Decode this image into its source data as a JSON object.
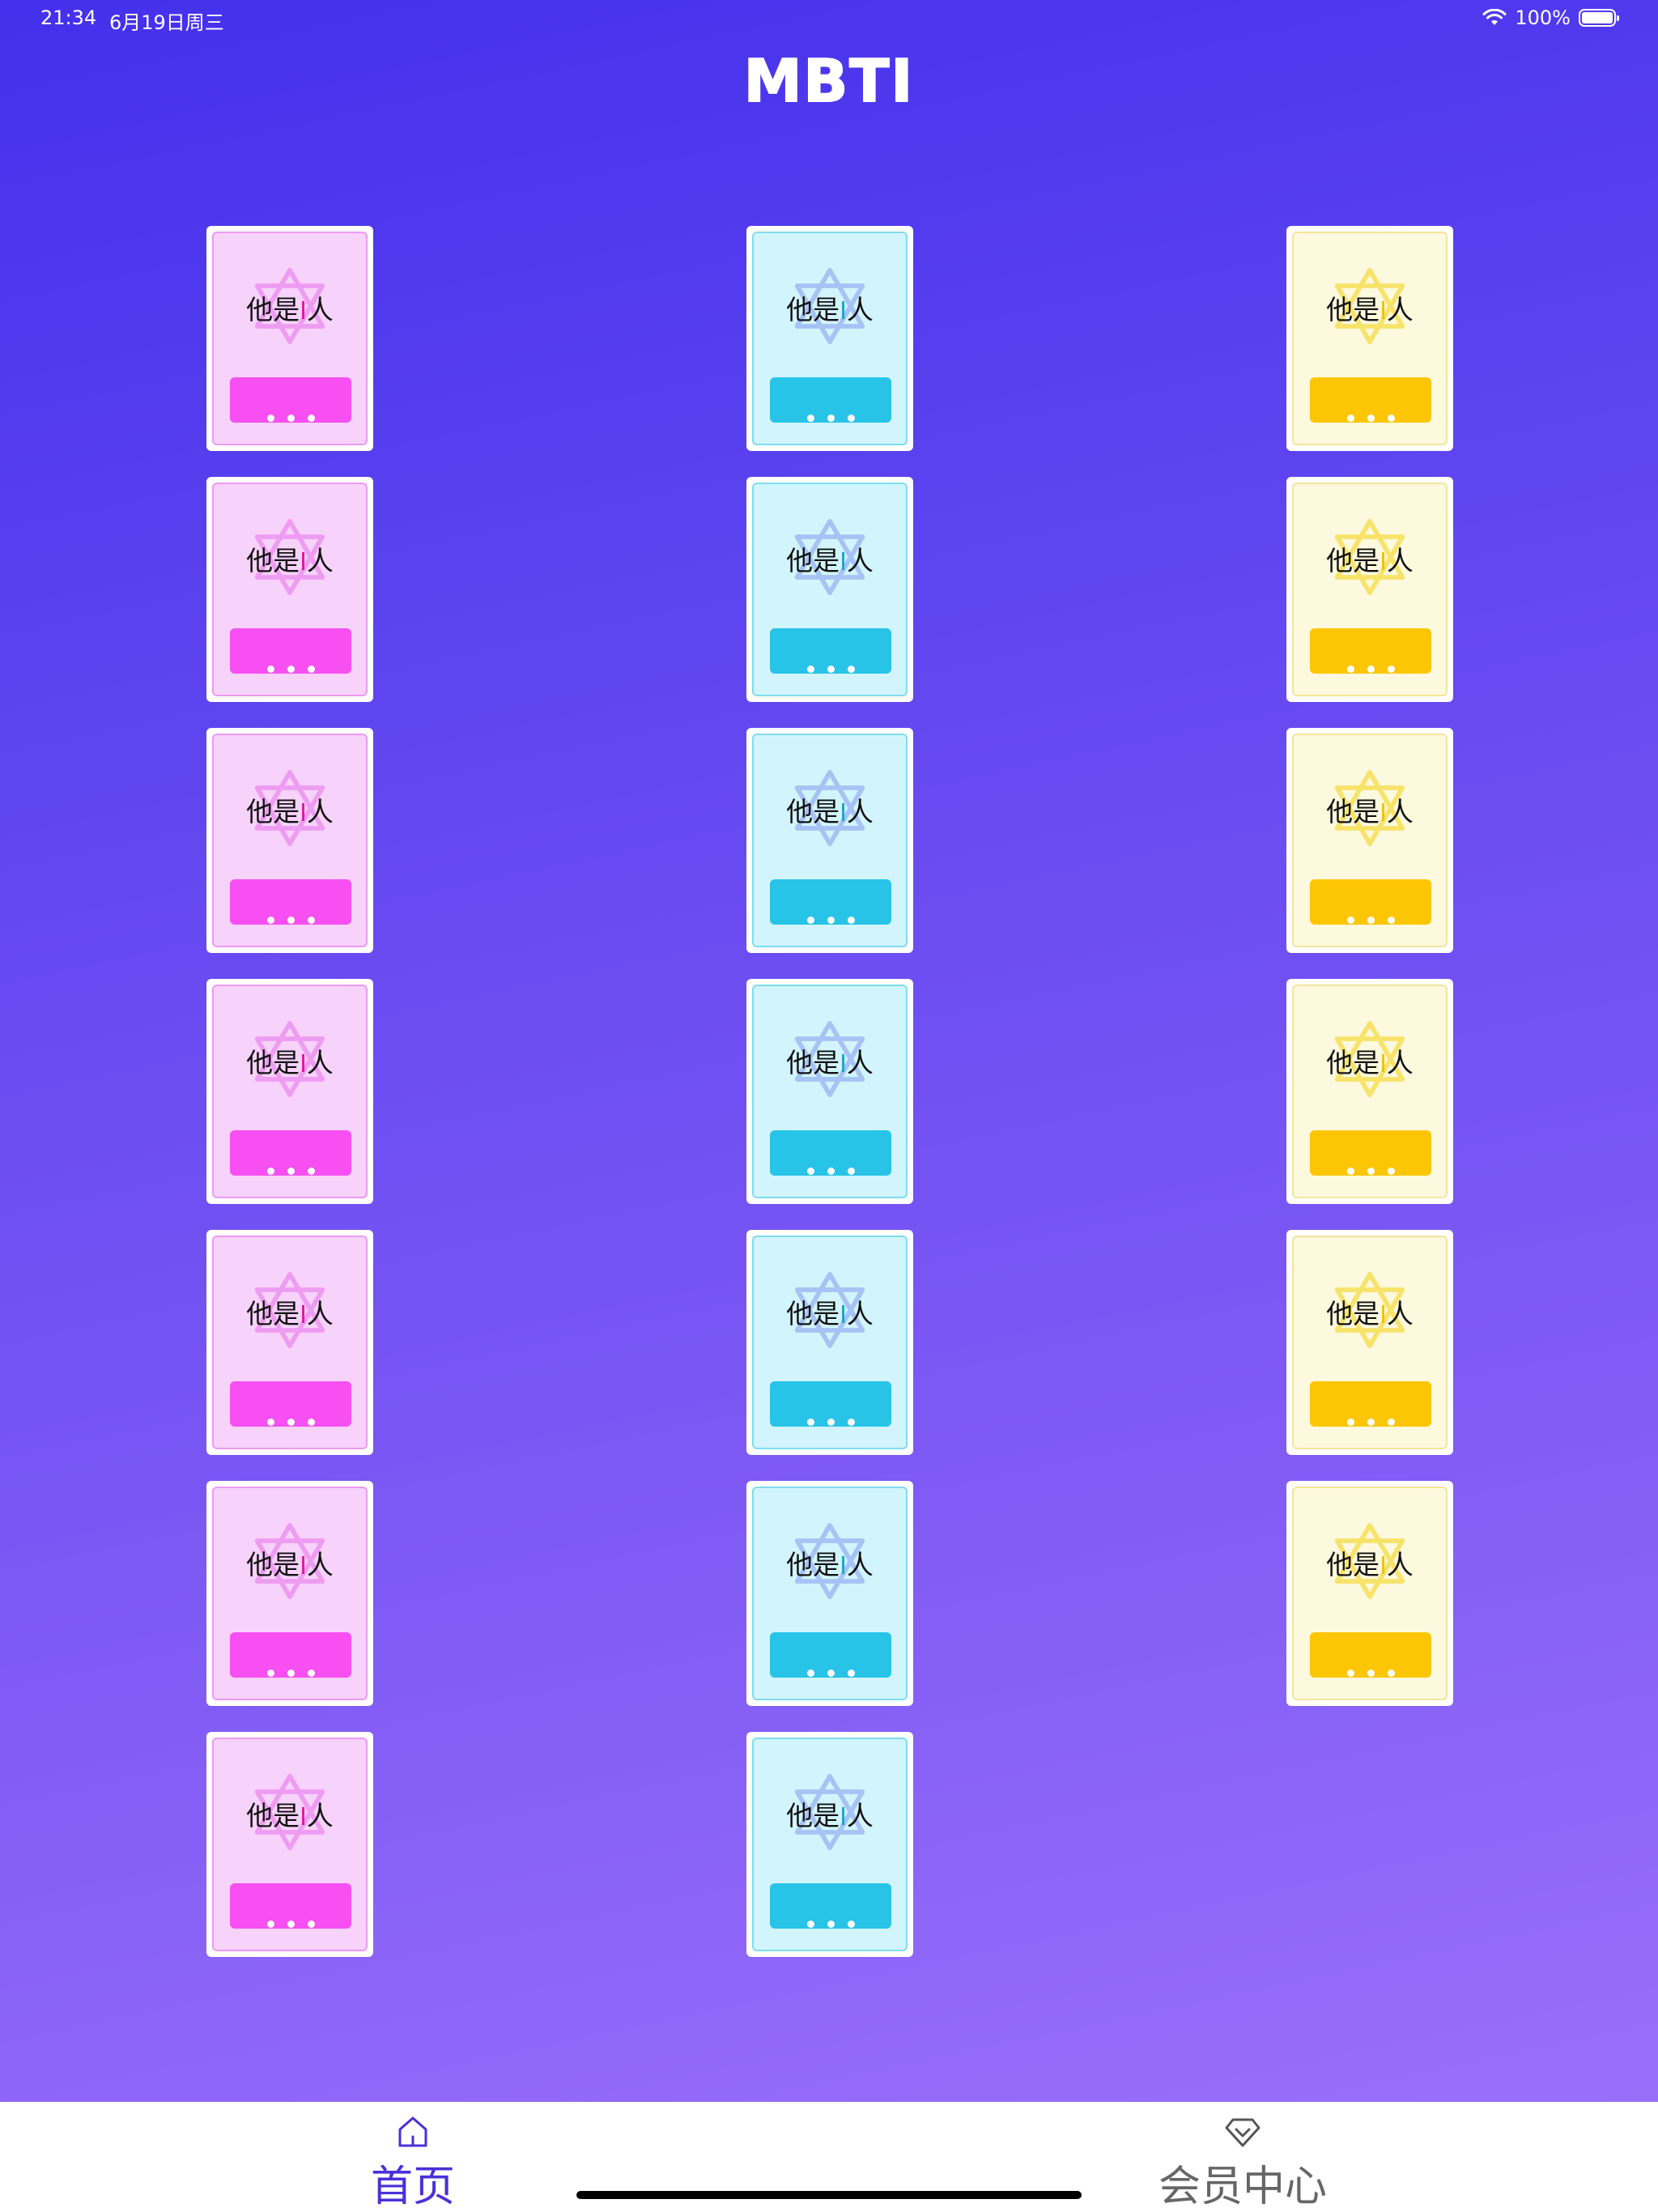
{
  "status_bar": {
    "time": "21:34",
    "date": "6月19日周三",
    "battery": "100%"
  },
  "header": {
    "title": "MBTI"
  },
  "card_text": {
    "prefix": "他是",
    "letter": "I",
    "suffix": "人"
  },
  "columns": [
    {
      "theme": "pink",
      "card_count": 7
    },
    {
      "theme": "cyan",
      "card_count": 7
    },
    {
      "theme": "yellow",
      "card_count": 6
    }
  ],
  "colors": {
    "pink_button": "#f74ff2",
    "cyan_button": "#27c4e8",
    "yellow_button": "#fdc605",
    "tab_active": "#4a30d8",
    "tab_inactive": "#666666"
  },
  "tab_bar": {
    "tabs": [
      {
        "label": "首页",
        "icon": "home-icon",
        "active": true
      },
      {
        "label": "会员中心",
        "icon": "diamond-icon",
        "active": false
      }
    ]
  }
}
